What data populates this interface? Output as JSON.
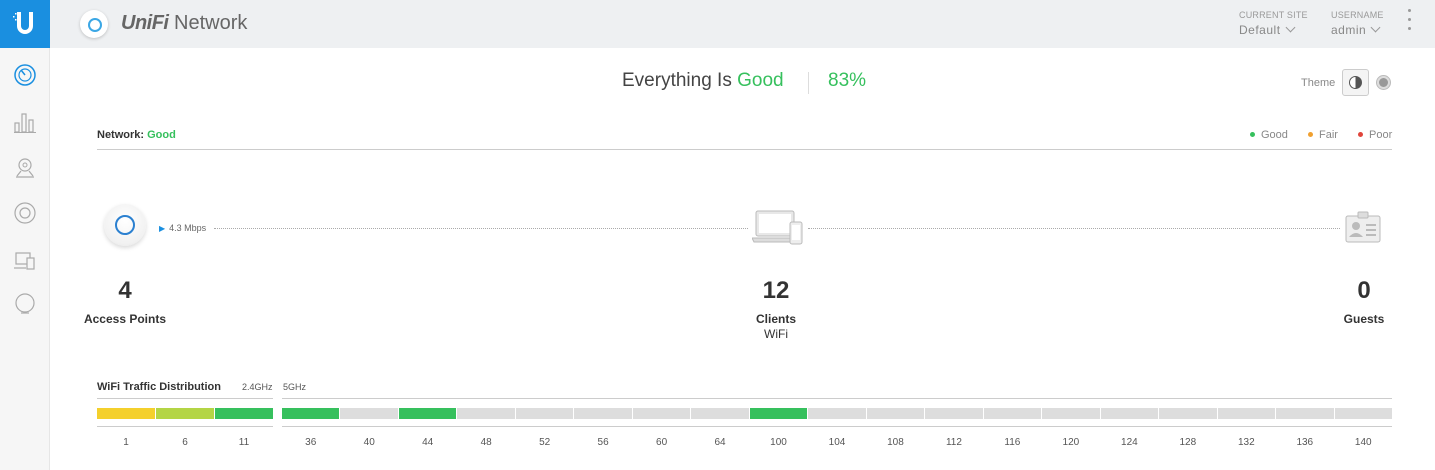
{
  "header": {
    "brand_prefix": "UniFi",
    "brand_suffix": " Network",
    "current_site_label": "CURRENT SITE",
    "current_site_value": "Default",
    "username_label": "USERNAME",
    "username_value": "admin"
  },
  "sidebar": {
    "items": [
      {
        "icon": "dashboard-icon"
      },
      {
        "icon": "statistics-icon"
      },
      {
        "icon": "map-icon"
      },
      {
        "icon": "devices-icon"
      },
      {
        "icon": "clients-icon"
      },
      {
        "icon": "insights-icon"
      }
    ]
  },
  "status": {
    "prefix": "Everything Is ",
    "state": "Good",
    "percent": "83%"
  },
  "theme": {
    "label": "Theme"
  },
  "network": {
    "label": "Network:",
    "state": "Good",
    "legend": [
      {
        "label": "Good",
        "color": "#36c05d"
      },
      {
        "label": "Fair",
        "color": "#f0a030"
      },
      {
        "label": "Poor",
        "color": "#e0453b"
      }
    ]
  },
  "topology": {
    "speed": "4.3 Mbps",
    "access_points": {
      "count": "4",
      "label": "Access Points"
    },
    "clients": {
      "count": "12",
      "label": "Clients",
      "sub": "WiFi"
    },
    "guests": {
      "count": "0",
      "label": "Guests"
    }
  },
  "wifi": {
    "title": "WiFi Traffic Distribution",
    "band_24": "2.4GHz",
    "band_5": "5GHz",
    "channels_24": [
      {
        "ch": "1",
        "color": "#f4d02c"
      },
      {
        "ch": "6",
        "color": "#b4d545"
      },
      {
        "ch": "11",
        "color": "#36c05d"
      }
    ],
    "channels_5": [
      {
        "ch": "36",
        "color": "#36c05d"
      },
      {
        "ch": "40",
        "color": "#dddddd"
      },
      {
        "ch": "44",
        "color": "#36c05d"
      },
      {
        "ch": "48",
        "color": "#dddddd"
      },
      {
        "ch": "52",
        "color": "#dddddd"
      },
      {
        "ch": "56",
        "color": "#dddddd"
      },
      {
        "ch": "60",
        "color": "#dddddd"
      },
      {
        "ch": "64",
        "color": "#dddddd"
      },
      {
        "ch": "100",
        "color": "#36c05d"
      },
      {
        "ch": "104",
        "color": "#dddddd"
      },
      {
        "ch": "108",
        "color": "#dddddd"
      },
      {
        "ch": "112",
        "color": "#dddddd"
      },
      {
        "ch": "116",
        "color": "#dddddd"
      },
      {
        "ch": "120",
        "color": "#dddddd"
      },
      {
        "ch": "124",
        "color": "#dddddd"
      },
      {
        "ch": "128",
        "color": "#dddddd"
      },
      {
        "ch": "132",
        "color": "#dddddd"
      },
      {
        "ch": "136",
        "color": "#dddddd"
      },
      {
        "ch": "140",
        "color": "#dddddd"
      }
    ]
  },
  "colors": {
    "accent": "#1a8fe0",
    "good": "#36c05d",
    "fair": "#f0a030",
    "poor": "#e0453b"
  }
}
